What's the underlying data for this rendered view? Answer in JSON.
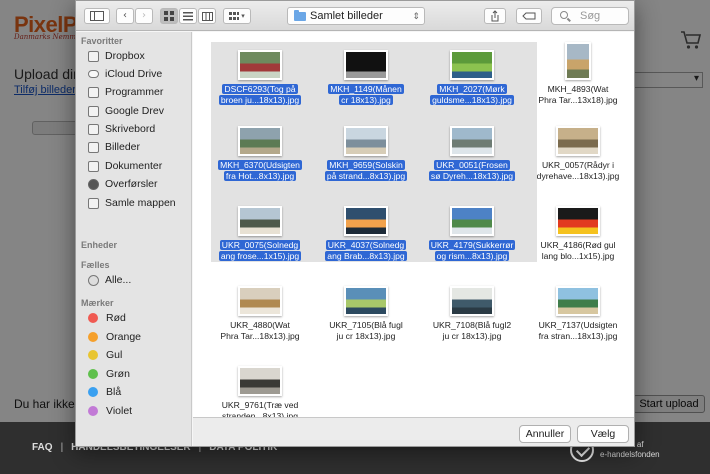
{
  "website": {
    "brand": "PixelP",
    "brand_tagline": "Danmarks Nemm",
    "upload_title": "Upload dine",
    "add_images_link": "Tilføj billeder",
    "status_text": "Du har ikke va",
    "start_upload": "Start upload",
    "footer_links": [
      "FAQ",
      "HANDELSBETINGELSER",
      "DATA POLITIK"
    ],
    "footer_badge": [
      "Godkendt af",
      "e-handelsfonden"
    ]
  },
  "dialog": {
    "location": "Samlet billeder",
    "search_placeholder": "Søg",
    "cancel_label": "Annuller",
    "choose_label": "Vælg"
  },
  "sidebar": {
    "favorites_header": "Favoritter",
    "favorites": [
      "Dropbox",
      "iCloud Drive",
      "Programmer",
      "Google Drev",
      "Skrivebord",
      "Billeder",
      "Dokumenter",
      "Overførsler",
      "Samle mappen"
    ],
    "devices_header": "Enheder",
    "shared_header": "Fælles",
    "shared": [
      "Alle..."
    ],
    "tags_header": "Mærker",
    "tags": [
      {
        "label": "Rød",
        "color": "#f05a52"
      },
      {
        "label": "Orange",
        "color": "#f5a02c"
      },
      {
        "label": "Gul",
        "color": "#e8c531"
      },
      {
        "label": "Grøn",
        "color": "#5fc04c"
      },
      {
        "label": "Blå",
        "color": "#3aa0f0"
      },
      {
        "label": "Violet",
        "color": "#c27ad6"
      }
    ]
  },
  "files": [
    {
      "line1": "DSCF6293(Tog på",
      "line2": "broen ju...18x13).jpg",
      "selected": true,
      "colors": [
        "#6e8a5e",
        "#a13a3a",
        "#c9d4c4"
      ]
    },
    {
      "line1": "MKH_1149(Månen",
      "line2": "cr 18x13).jpg",
      "selected": true,
      "colors": [
        "#111111",
        "#111111",
        "#9a9a9a"
      ]
    },
    {
      "line1": "MKH_2027(Mørk",
      "line2": "guldsme...18x13).jpg",
      "selected": true,
      "colors": [
        "#5c9a3a",
        "#8cc24f",
        "#2e5f8a"
      ]
    },
    {
      "line1": "MKH_4893(Wat",
      "line2": "Phra Tar...13x18).jpg",
      "selected": false,
      "colors": [
        "#a7b8c6",
        "#c9a46a",
        "#6f7b54"
      ]
    },
    {
      "line1": "MKH_6370(Udsigten",
      "line2": "fra Hot...8x13).jpg",
      "selected": true,
      "colors": [
        "#8ea2ad",
        "#5d7b54",
        "#b4a88a"
      ]
    },
    {
      "line1": "MKH_9659(Solskin",
      "line2": "på strand...8x13).jpg",
      "selected": true,
      "colors": [
        "#c9d6e0",
        "#7d8f9c",
        "#d7cdb7"
      ]
    },
    {
      "line1": "UKR_0051(Frosen",
      "line2": "sø Dyreh...18x13).jpg",
      "selected": true,
      "colors": [
        "#9fb9cc",
        "#6e7c74",
        "#dde5ea"
      ]
    },
    {
      "line1": "UKR_0057(Rådyr i",
      "line2": "dyrehave...18x13).jpg",
      "selected": false,
      "colors": [
        "#c6b08a",
        "#7b6b4e",
        "#e1d8c6"
      ]
    },
    {
      "line1": "UKR_0075(Solnedg",
      "line2": "ang frose...1x15).jpg",
      "selected": true,
      "colors": [
        "#b5c6d3",
        "#4f5a4b",
        "#e8e1d3"
      ]
    },
    {
      "line1": "UKR_4037(Solnedg",
      "line2": "ang Brab...8x13).jpg",
      "selected": true,
      "colors": [
        "#2f4f6e",
        "#f2a24c",
        "#1d2b38"
      ]
    },
    {
      "line1": "UKR_4179(Sukkerrør",
      "line2": "og rism...8x13).jpg",
      "selected": true,
      "colors": [
        "#4d82c6",
        "#4f8a4a",
        "#dfe6ea"
      ]
    },
    {
      "line1": "UKR_4186(Rød gul",
      "line2": "lang blo...1x15).jpg",
      "selected": false,
      "colors": [
        "#1a1a1a",
        "#e23a20",
        "#f5c21e"
      ]
    },
    {
      "line1": "UKR_4880(Wat",
      "line2": "Phra Tar...18x13).jpg",
      "selected": false,
      "colors": [
        "#d9cfbd",
        "#b08a52",
        "#ece6da"
      ]
    },
    {
      "line1": "UKR_7105(Blå fugl",
      "line2": "ju cr 18x13).jpg",
      "selected": false,
      "colors": [
        "#5a8fb8",
        "#a8c86a",
        "#2c4a60"
      ]
    },
    {
      "line1": "UKR_7108(Blå fugl2",
      "line2": "ju cr 18x13).jpg",
      "selected": false,
      "colors": [
        "#e4e7e3",
        "#3f5a6a",
        "#2a3a44"
      ]
    },
    {
      "line1": "UKR_7137(Udsigten",
      "line2": "fra stran...18x13).jpg",
      "selected": false,
      "colors": [
        "#8fc1e0",
        "#3f7d4a",
        "#d7c7a0"
      ]
    },
    {
      "line1": "UKR_9761(Træ ved",
      "line2": "stranden...8x13).jpg",
      "selected": false,
      "colors": [
        "#d9d6cf",
        "#3a3a36",
        "#9d9a92"
      ]
    }
  ]
}
